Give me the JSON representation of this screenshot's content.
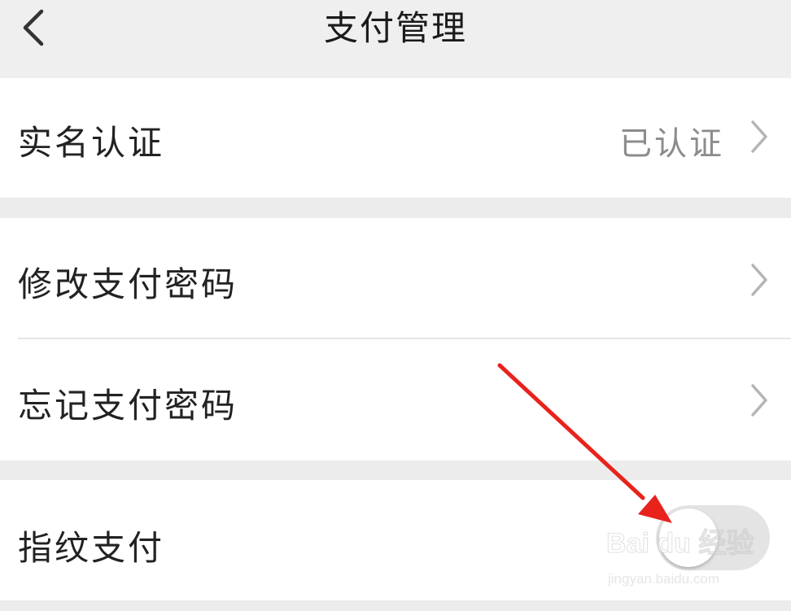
{
  "nav": {
    "title": "支付管理",
    "back_icon": "chevron-left-icon"
  },
  "groups": [
    {
      "items": [
        {
          "label": "实名认证",
          "value": "已认证",
          "accessory": "chevron-right-icon"
        }
      ]
    },
    {
      "items": [
        {
          "label": "修改支付密码",
          "accessory": "chevron-right-icon"
        },
        {
          "label": "忘记支付密码",
          "accessory": "chevron-right-icon"
        }
      ]
    },
    {
      "items": [
        {
          "label": "指纹支付",
          "accessory": "toggle-switch",
          "toggle_on": false
        }
      ]
    }
  ],
  "watermark": {
    "brand": "Bai du 经验",
    "url": "jingyan.baidu.com"
  },
  "colors": {
    "background": "#ececec",
    "cell_background": "#ffffff",
    "annotation_arrow": "#e8231c",
    "toggle_off_track": "#e4e4e4",
    "secondary_text": "#8c8c8c"
  }
}
